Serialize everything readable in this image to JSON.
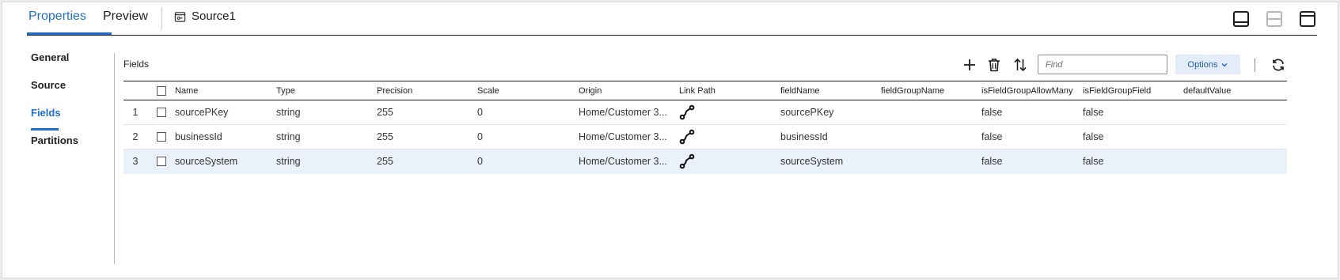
{
  "header": {
    "tabs": [
      "Properties",
      "Preview"
    ],
    "source_name": "Source1",
    "source_icon": "source-object-icon",
    "layout_icons": [
      "panel-bottom-icon",
      "panel-split-icon",
      "panel-top-icon"
    ]
  },
  "nav": {
    "items": [
      "General",
      "Source",
      "Fields",
      "Partitions"
    ],
    "active": "Fields"
  },
  "toolbar": {
    "title": "Fields",
    "find_placeholder": "Find",
    "options_label": "Options",
    "icons": [
      "add-icon",
      "delete-icon",
      "sort-icon",
      "refresh-icon"
    ]
  },
  "table": {
    "headers": [
      "Name",
      "Type",
      "Precision",
      "Scale",
      "Origin",
      "Link Path",
      "fieldName",
      "fieldGroupName",
      "isFieldGroupAllowMany",
      "isFieldGroupField",
      "defaultValue"
    ],
    "rows": [
      {
        "index": "1",
        "name": "sourcePKey",
        "type": "string",
        "precision": "255",
        "scale": "0",
        "origin": "Home/Customer 3...",
        "field_name": "sourcePKey",
        "field_group_name": "",
        "allow_many": "false",
        "group_field": "false",
        "default_value": ""
      },
      {
        "index": "2",
        "name": "businessId",
        "type": "string",
        "precision": "255",
        "scale": "0",
        "origin": "Home/Customer 3...",
        "field_name": "businessId",
        "field_group_name": "",
        "allow_many": "false",
        "group_field": "false",
        "default_value": ""
      },
      {
        "index": "3",
        "name": "sourceSystem",
        "type": "string",
        "precision": "255",
        "scale": "0",
        "origin": "Home/Customer 3...",
        "field_name": "sourceSystem",
        "field_group_name": "",
        "allow_many": "false",
        "group_field": "false",
        "default_value": ""
      }
    ],
    "selected_row": 3
  },
  "colors": {
    "accent": "#1f6fd0",
    "selected_row": "#eaf1fb",
    "options_bg": "#e3ecf8"
  }
}
